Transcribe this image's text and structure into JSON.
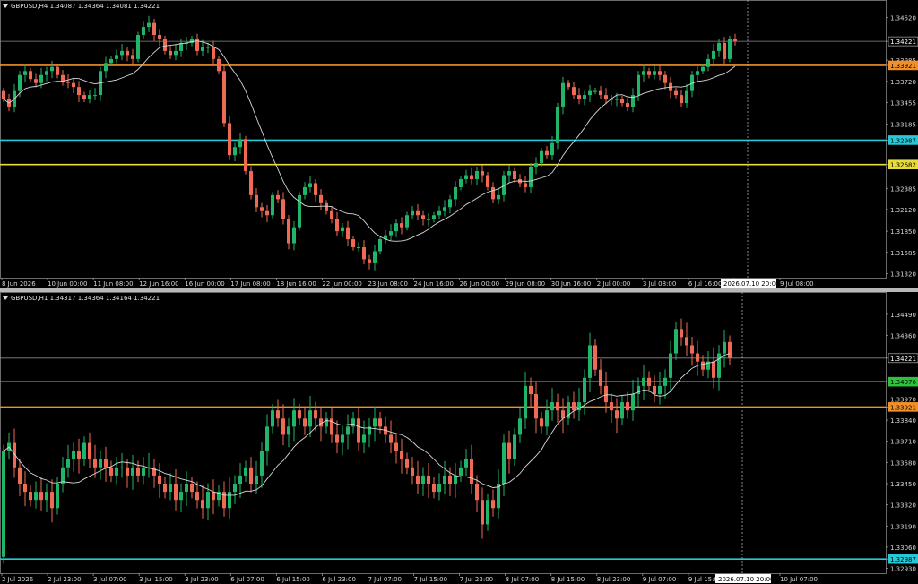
{
  "colors": {
    "background": "#000000",
    "bull": "#21b56a",
    "bear": "#ef6a55",
    "ma": "#d8d8d8",
    "axis_text": "#d6d6d6",
    "bid_line": "#8a8a8a",
    "orange": "#f0902a",
    "cyan": "#27c8d8",
    "yellow": "#e8dc3a",
    "green": "#2cc23c"
  },
  "charts": [
    {
      "id": "h4",
      "title": "GBPUSD,H4  1.34087 1.34364 1.34081 1.34221",
      "price_labels": [
        "1.34520",
        "1.34221",
        "1.33985",
        "1.33921",
        "1.33720",
        "1.33455",
        "1.33185",
        "1.32987",
        "1.32682",
        "1.32385",
        "1.32120",
        "1.31850",
        "1.31585",
        "1.31320"
      ],
      "time_labels": [
        "8 Jun 2026",
        "10 Jun 00:00",
        "11 Jun 08:00",
        "12 Jun 16:00",
        "16 Jun 00:00",
        "17 Jun 08:00",
        "18 Jun 16:00",
        "22 Jun 00:00",
        "23 Jun 08:00",
        "24 Jun 16:00",
        "26 Jun 00:00",
        "29 Jun 08:00",
        "30 Jun 16:00",
        "2 Jul 00:00",
        "3 Jul 08:00",
        "6 Jul 16:00",
        "8 Jul 00:00",
        "9 Jul 08:00"
      ],
      "cursor_time": "2026.07.10 20:00",
      "levels": [
        {
          "price": 1.34221,
          "label": "1.34221",
          "color_key": "bid_line"
        },
        {
          "price": 1.33921,
          "label": "1.33921",
          "color_key": "orange"
        },
        {
          "price": 1.32987,
          "label": "1.32987",
          "color_key": "cyan"
        },
        {
          "price": 1.32682,
          "label": "1.32682",
          "color_key": "yellow"
        }
      ]
    },
    {
      "id": "h1",
      "title": "GBPUSD,H1  1.34317 1.34364 1.34164 1.34221",
      "price_labels": [
        "1.34490",
        "1.34360",
        "1.34221",
        "1.34076",
        "1.33970",
        "1.33921",
        "1.33840",
        "1.33710",
        "1.33580",
        "1.33450",
        "1.33320",
        "1.33190",
        "1.33060",
        "1.32987",
        "1.32930"
      ],
      "time_labels": [
        "2 Jul 2026",
        "2 Jul 23:00",
        "3 Jul 07:00",
        "3 Jul 15:00",
        "3 Jul 23:00",
        "6 Jul 07:00",
        "6 Jul 15:00",
        "6 Jul 23:00",
        "7 Jul 07:00",
        "7 Jul 15:00",
        "7 Jul 23:00",
        "8 Jul 07:00",
        "8 Jul 15:00",
        "8 Jul 23:00",
        "9 Jul 07:00",
        "9 Jul 15:00",
        "9 Jul 23:00",
        "10 Jul 07:00"
      ],
      "cursor_time": "2026.07.10 20:00",
      "levels": [
        {
          "price": 1.34221,
          "label": "1.34221",
          "color_key": "bid_line"
        },
        {
          "price": 1.34076,
          "label": "1.34076",
          "color_key": "green"
        },
        {
          "price": 1.33921,
          "label": "1.33921",
          "color_key": "orange"
        },
        {
          "price": 1.32987,
          "label": "1.32987",
          "color_key": "cyan"
        }
      ]
    }
  ],
  "chart_data": [
    {
      "type": "candlestick",
      "symbol": "GBPUSD",
      "timeframe": "H4",
      "ylim": [
        1.3127,
        1.3458
      ],
      "ma_start_x": 0,
      "x": [
        0,
        6,
        12,
        18,
        24,
        30,
        36,
        42,
        48,
        54,
        60,
        66,
        72,
        78,
        84,
        90,
        96,
        102,
        108,
        114,
        120,
        126,
        132,
        138,
        144,
        150,
        156,
        162,
        168,
        174,
        180,
        186,
        192,
        198,
        204,
        210,
        216,
        222,
        228,
        234,
        240,
        246,
        252,
        258,
        264,
        270,
        276,
        282,
        288,
        294,
        300,
        306,
        312,
        318,
        324,
        330,
        336,
        342,
        348,
        354,
        360,
        366,
        372,
        378,
        384,
        390,
        396,
        402,
        408,
        414,
        420,
        426,
        432,
        438,
        444,
        450,
        456,
        462,
        468,
        474,
        480,
        486,
        492,
        498,
        504,
        510,
        516,
        522,
        528,
        534,
        540,
        546,
        552,
        558,
        564,
        570,
        576,
        582,
        588,
        594,
        600,
        606,
        612,
        618,
        624,
        630,
        636,
        642,
        648,
        654,
        660,
        666,
        672,
        678,
        684,
        690,
        696,
        702,
        708,
        714,
        720,
        726,
        732,
        738,
        744,
        750,
        756,
        762,
        768,
        774,
        780,
        786,
        792,
        798,
        804,
        810,
        816
      ],
      "open": [
        1.336,
        1.335,
        1.334,
        1.336,
        1.338,
        1.3385,
        1.3375,
        1.337,
        1.338,
        1.3385,
        1.339,
        1.338,
        1.3372,
        1.337,
        1.3365,
        1.3355,
        1.335,
        1.3355,
        1.3355,
        1.3385,
        1.3395,
        1.34,
        1.3405,
        1.341,
        1.3405,
        1.34,
        1.343,
        1.344,
        1.3445,
        1.343,
        1.3425,
        1.341,
        1.3405,
        1.341,
        1.342,
        1.342,
        1.3425,
        1.341,
        1.3415,
        1.3415,
        1.34,
        1.3385,
        1.332,
        1.328,
        1.329,
        1.33,
        1.326,
        1.323,
        1.3215,
        1.321,
        1.3205,
        1.323,
        1.3225,
        1.32,
        1.317,
        1.319,
        1.323,
        1.324,
        1.3245,
        1.323,
        1.322,
        1.321,
        1.32,
        1.3185,
        1.319,
        1.3175,
        1.3165,
        1.3165,
        1.315,
        1.3145,
        1.316,
        1.3175,
        1.318,
        1.3185,
        1.3195,
        1.319,
        1.3205,
        1.321,
        1.3205,
        1.32,
        1.32,
        1.3205,
        1.321,
        1.3215,
        1.3225,
        1.324,
        1.325,
        1.3255,
        1.325,
        1.326,
        1.3255,
        1.324,
        1.3225,
        1.323,
        1.3255,
        1.326,
        1.325,
        1.3245,
        1.324,
        1.3265,
        1.327,
        1.3285,
        1.328,
        1.3295,
        1.334,
        1.337,
        1.3365,
        1.3355,
        1.335,
        1.3355,
        1.336,
        1.336,
        1.3355,
        1.335,
        1.335,
        1.335,
        1.3345,
        1.334,
        1.3355,
        1.338,
        1.3385,
        1.338,
        1.3385,
        1.338,
        1.337,
        1.336,
        1.3355,
        1.3345,
        1.336,
        1.338,
        1.3385,
        1.339,
        1.34,
        1.341,
        1.342,
        1.34,
        1.3425
      ],
      "close": [
        1.335,
        1.334,
        1.336,
        1.338,
        1.3385,
        1.3375,
        1.337,
        1.338,
        1.3385,
        1.339,
        1.338,
        1.3372,
        1.337,
        1.3365,
        1.3355,
        1.335,
        1.3355,
        1.3355,
        1.3385,
        1.3395,
        1.34,
        1.3405,
        1.341,
        1.3405,
        1.34,
        1.343,
        1.344,
        1.3445,
        1.343,
        1.3425,
        1.341,
        1.3405,
        1.341,
        1.342,
        1.342,
        1.3425,
        1.341,
        1.3415,
        1.3415,
        1.34,
        1.3385,
        1.332,
        1.328,
        1.329,
        1.33,
        1.326,
        1.323,
        1.3215,
        1.321,
        1.3205,
        1.323,
        1.3225,
        1.32,
        1.317,
        1.319,
        1.323,
        1.324,
        1.3245,
        1.323,
        1.322,
        1.321,
        1.32,
        1.3185,
        1.319,
        1.3175,
        1.3165,
        1.3165,
        1.315,
        1.3145,
        1.316,
        1.3175,
        1.318,
        1.3185,
        1.3195,
        1.319,
        1.3205,
        1.321,
        1.3205,
        1.32,
        1.32,
        1.3205,
        1.321,
        1.3215,
        1.3225,
        1.324,
        1.325,
        1.3255,
        1.325,
        1.326,
        1.3255,
        1.324,
        1.3225,
        1.323,
        1.3255,
        1.326,
        1.325,
        1.3245,
        1.324,
        1.3265,
        1.327,
        1.3285,
        1.328,
        1.3295,
        1.334,
        1.337,
        1.3365,
        1.3355,
        1.335,
        1.3355,
        1.336,
        1.336,
        1.3355,
        1.335,
        1.335,
        1.335,
        1.3345,
        1.334,
        1.3355,
        1.338,
        1.3385,
        1.338,
        1.3385,
        1.338,
        1.337,
        1.336,
        1.3355,
        1.3345,
        1.336,
        1.338,
        1.3385,
        1.339,
        1.34,
        1.341,
        1.342,
        1.34,
        1.3425,
        1.3422
      ]
    },
    {
      "type": "candlestick",
      "symbol": "GBPUSD",
      "timeframe": "H1",
      "ylim": [
        1.329,
        1.3455
      ],
      "ma_start_x": 0,
      "x": [
        0,
        6,
        12,
        18,
        24,
        30,
        36,
        42,
        48,
        54,
        60,
        66,
        72,
        78,
        84,
        90,
        96,
        102,
        108,
        114,
        120,
        126,
        132,
        138,
        144,
        150,
        156,
        162,
        168,
        174,
        180,
        186,
        192,
        198,
        204,
        210,
        216,
        222,
        228,
        234,
        240,
        246,
        252,
        258,
        264,
        270,
        276,
        282,
        288,
        294,
        300,
        306,
        312,
        318,
        324,
        330,
        336,
        342,
        348,
        354,
        360,
        366,
        372,
        378,
        384,
        390,
        396,
        402,
        408,
        414,
        420,
        426,
        432,
        438,
        444,
        450,
        456,
        462,
        468,
        474,
        480,
        486,
        492,
        498,
        504,
        510,
        516,
        522,
        528,
        534,
        540,
        546,
        552,
        558,
        564,
        570,
        576,
        582,
        588,
        594,
        600,
        606,
        612,
        618,
        624,
        630,
        636,
        642,
        648,
        654,
        660,
        666,
        672,
        678,
        684,
        690,
        696,
        702,
        708,
        714,
        720,
        726,
        732,
        738,
        744,
        750,
        756,
        762,
        768,
        774,
        780,
        786,
        792,
        798,
        804,
        810,
        816
      ],
      "open": [
        1.33,
        1.3365,
        1.337,
        1.3355,
        1.3345,
        1.334,
        1.3335,
        1.334,
        1.3335,
        1.334,
        1.333,
        1.3345,
        1.3355,
        1.336,
        1.3365,
        1.336,
        1.337,
        1.336,
        1.3355,
        1.336,
        1.3355,
        1.335,
        1.3355,
        1.3355,
        1.335,
        1.3355,
        1.335,
        1.3355,
        1.3355,
        1.335,
        1.3345,
        1.334,
        1.3345,
        1.3335,
        1.334,
        1.3345,
        1.334,
        1.3335,
        1.333,
        1.334,
        1.3335,
        1.334,
        1.333,
        1.334,
        1.3345,
        1.335,
        1.3355,
        1.3345,
        1.335,
        1.3365,
        1.338,
        1.339,
        1.3385,
        1.3375,
        1.338,
        1.339,
        1.3385,
        1.338,
        1.339,
        1.3385,
        1.338,
        1.3385,
        1.3375,
        1.337,
        1.3375,
        1.338,
        1.3385,
        1.337,
        1.3375,
        1.338,
        1.3385,
        1.338,
        1.3375,
        1.337,
        1.3365,
        1.336,
        1.3355,
        1.335,
        1.3345,
        1.335,
        1.3345,
        1.334,
        1.3345,
        1.335,
        1.3345,
        1.335,
        1.3355,
        1.336,
        1.3345,
        1.3335,
        1.332,
        1.3335,
        1.333,
        1.3345,
        1.337,
        1.336,
        1.3375,
        1.3385,
        1.3405,
        1.34,
        1.3385,
        1.338,
        1.339,
        1.3395,
        1.339,
        1.3385,
        1.3395,
        1.339,
        1.3395,
        1.341,
        1.343,
        1.3415,
        1.3405,
        1.3395,
        1.339,
        1.3385,
        1.3395,
        1.339,
        1.34,
        1.3405,
        1.341,
        1.3405,
        1.34,
        1.3405,
        1.341,
        1.3425,
        1.344,
        1.3435,
        1.343,
        1.3425,
        1.342,
        1.3415,
        1.342,
        1.341,
        1.3425,
        1.3432
      ],
      "close": [
        1.3365,
        1.337,
        1.3355,
        1.3345,
        1.334,
        1.3335,
        1.334,
        1.3335,
        1.334,
        1.333,
        1.3345,
        1.3355,
        1.336,
        1.3365,
        1.336,
        1.337,
        1.336,
        1.3355,
        1.336,
        1.3355,
        1.335,
        1.3355,
        1.3355,
        1.335,
        1.3355,
        1.335,
        1.3355,
        1.3355,
        1.335,
        1.3345,
        1.334,
        1.3345,
        1.3335,
        1.334,
        1.3345,
        1.334,
        1.3335,
        1.333,
        1.334,
        1.3335,
        1.334,
        1.333,
        1.334,
        1.3345,
        1.335,
        1.3355,
        1.3345,
        1.335,
        1.3365,
        1.338,
        1.339,
        1.3385,
        1.3375,
        1.338,
        1.339,
        1.3385,
        1.338,
        1.339,
        1.3385,
        1.338,
        1.3385,
        1.3375,
        1.337,
        1.3375,
        1.338,
        1.3385,
        1.337,
        1.3375,
        1.338,
        1.3385,
        1.338,
        1.3375,
        1.337,
        1.3365,
        1.336,
        1.3355,
        1.335,
        1.3345,
        1.335,
        1.3345,
        1.334,
        1.3345,
        1.335,
        1.3345,
        1.335,
        1.3355,
        1.336,
        1.3345,
        1.3335,
        1.332,
        1.3335,
        1.333,
        1.3345,
        1.337,
        1.336,
        1.3375,
        1.3385,
        1.3405,
        1.34,
        1.3385,
        1.338,
        1.339,
        1.3395,
        1.339,
        1.3385,
        1.3395,
        1.339,
        1.3395,
        1.341,
        1.343,
        1.3415,
        1.3405,
        1.3395,
        1.339,
        1.3385,
        1.3395,
        1.339,
        1.34,
        1.3405,
        1.341,
        1.3405,
        1.34,
        1.3405,
        1.341,
        1.3425,
        1.344,
        1.3435,
        1.343,
        1.3425,
        1.342,
        1.3415,
        1.342,
        1.341,
        1.3425,
        1.3432,
        1.3422
      ]
    }
  ]
}
